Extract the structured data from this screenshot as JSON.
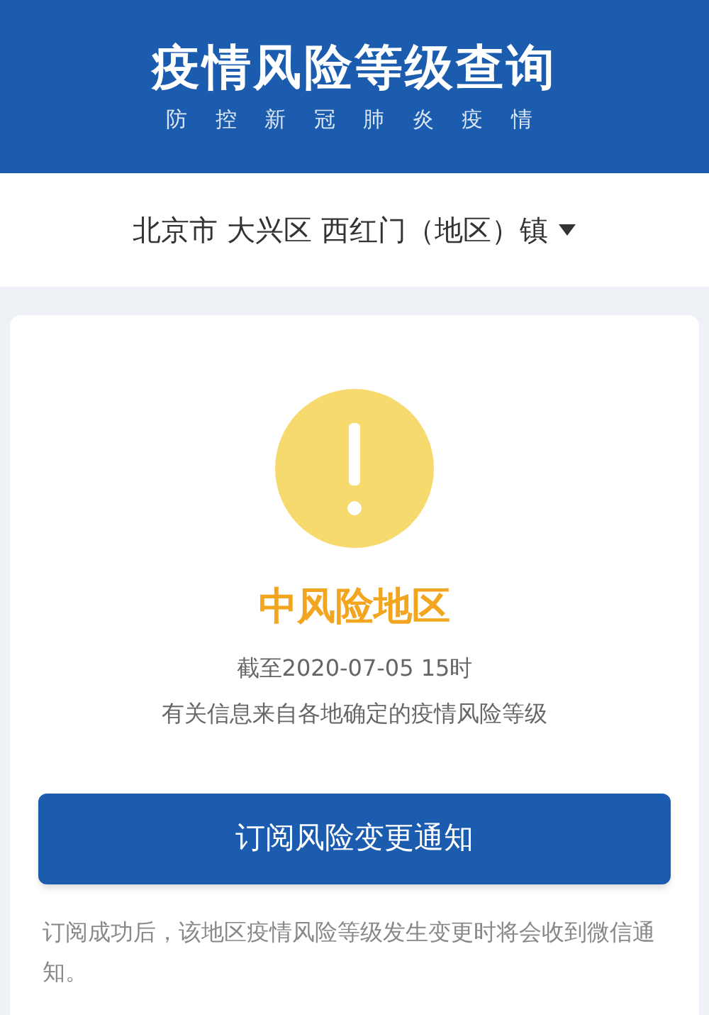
{
  "header": {
    "title": "疫情风险等级查询",
    "subtitle": "防 控 新 冠 肺 炎 疫 情"
  },
  "location": {
    "value": "北京市 大兴区 西红门（地区）镇"
  },
  "result": {
    "level": "中风险地区",
    "time": "截至2020-07-05 15时",
    "source": "有关信息来自各地确定的疫情风险等级"
  },
  "subscribe_button": "订阅风险变更通知",
  "note": "订阅成功后，该地区疫情风险等级发生变更时将会收到微信通知。"
}
